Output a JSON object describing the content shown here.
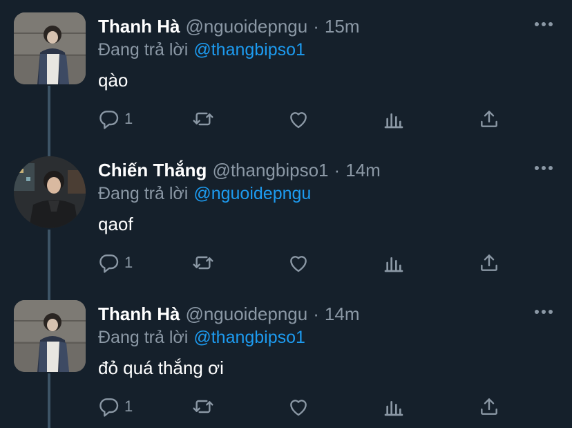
{
  "colors": {
    "background": "#15202b",
    "text": "#ffffff",
    "muted": "#8b98a5",
    "link": "#1d9bf0",
    "thread_line": "#3d5466"
  },
  "tweets": [
    {
      "name": "Thanh Hà",
      "handle": "@nguoidepngu",
      "separator": "·",
      "time": "15m",
      "replying_prefix": "Đang trả lời",
      "replying_to": "@thangbipso1",
      "text": "qào",
      "reply_count": "1",
      "avatar": "avatar-photo"
    },
    {
      "name": "Chiến Thắng",
      "handle": "@thangbipso1",
      "separator": "·",
      "time": "14m",
      "replying_prefix": "Đang trả lời",
      "replying_to": "@nguoidepngu",
      "text": "qaof",
      "reply_count": "1",
      "avatar": "avatar-photo"
    },
    {
      "name": "Thanh Hà",
      "handle": "@nguoidepngu",
      "separator": "·",
      "time": "14m",
      "replying_prefix": "Đang trả lời",
      "replying_to": "@thangbipso1",
      "text": "đỏ quá thắng ơi",
      "reply_count": "1",
      "avatar": "avatar-photo"
    }
  ],
  "icons": {
    "reply": "reply-icon",
    "retweet": "retweet-icon",
    "like": "heart-icon",
    "analytics": "analytics-icon",
    "share": "share-icon",
    "more": "more-icon"
  }
}
